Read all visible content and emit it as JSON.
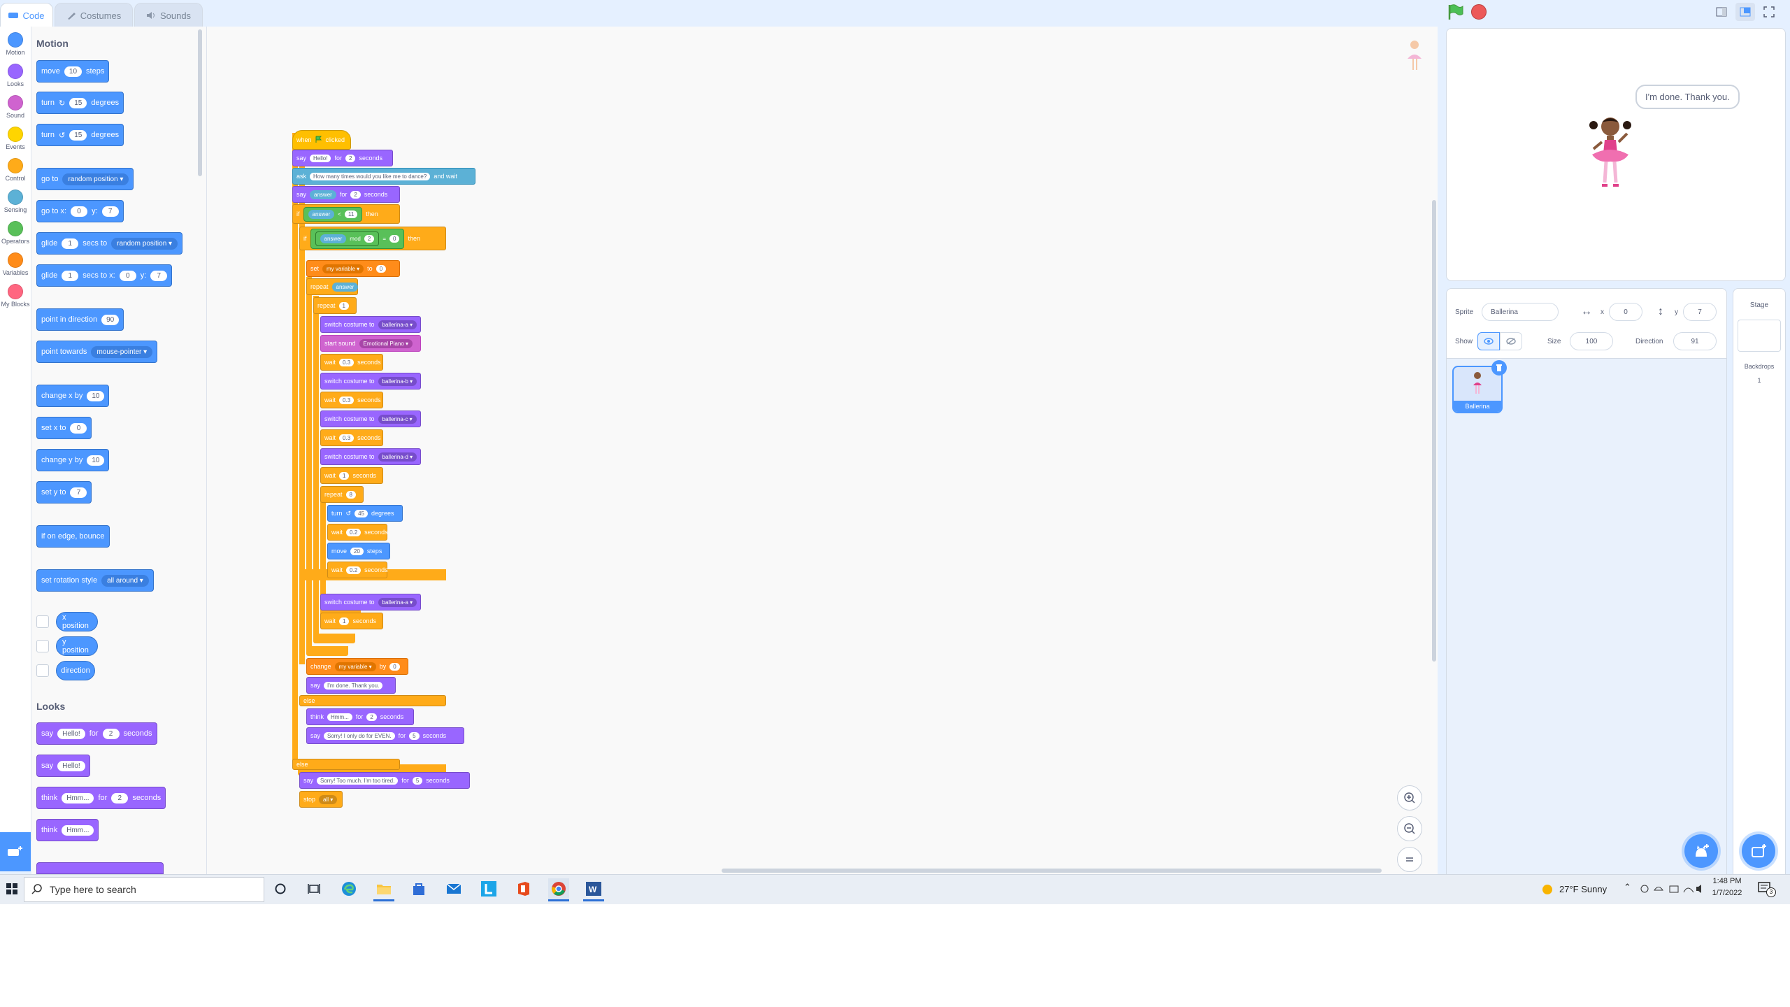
{
  "tabs": {
    "code": "Code",
    "costumes": "Costumes",
    "sounds": "Sounds"
  },
  "categories": [
    {
      "label": "Motion",
      "color": "#4c97ff"
    },
    {
      "label": "Looks",
      "color": "#9966ff"
    },
    {
      "label": "Sound",
      "color": "#cf63cf"
    },
    {
      "label": "Events",
      "color": "#ffd500"
    },
    {
      "label": "Control",
      "color": "#ffab19"
    },
    {
      "label": "Sensing",
      "color": "#5cb1d6"
    },
    {
      "label": "Operators",
      "color": "#59c059"
    },
    {
      "label": "Variables",
      "color": "#ff8c1a"
    },
    {
      "label": "My Blocks",
      "color": "#ff6680"
    }
  ],
  "palette": {
    "motion_title": "Motion",
    "looks_title": "Looks",
    "move": {
      "a": "move",
      "v": "10",
      "b": "steps"
    },
    "turn_cw": {
      "a": "turn",
      "v": "15",
      "b": "degrees"
    },
    "turn_ccw": {
      "a": "turn",
      "v": "15",
      "b": "degrees"
    },
    "goto": {
      "a": "go to",
      "d": "random position"
    },
    "gotoxy": {
      "a": "go to x:",
      "x": "0",
      "yl": "y:",
      "y": "7"
    },
    "glide": {
      "a": "glide",
      "v": "1",
      "b": "secs to",
      "d": "random position"
    },
    "glidexy": {
      "a": "glide",
      "v": "1",
      "b": "secs to x:",
      "x": "0",
      "yl": "y:",
      "y": "7"
    },
    "point_dir": {
      "a": "point in direction",
      "v": "90"
    },
    "point_towards": {
      "a": "point towards",
      "d": "mouse-pointer"
    },
    "change_x": {
      "a": "change x by",
      "v": "10"
    },
    "set_x": {
      "a": "set x to",
      "v": "0"
    },
    "change_y": {
      "a": "change y by",
      "v": "10"
    },
    "set_y": {
      "a": "set y to",
      "v": "7"
    },
    "bounce": "if on edge, bounce",
    "rot_style": {
      "a": "set rotation style",
      "d": "all around"
    },
    "reporters": [
      "x position",
      "y position",
      "direction"
    ],
    "say_for": {
      "a": "say",
      "v": "Hello!",
      "b": "for",
      "n": "2",
      "c": "seconds"
    },
    "say": {
      "a": "say",
      "v": "Hello!"
    },
    "think_for": {
      "a": "think",
      "v": "Hmm...",
      "b": "for",
      "n": "2",
      "c": "seconds"
    },
    "think": {
      "a": "think",
      "v": "Hmm..."
    }
  },
  "script": {
    "hat": {
      "a": "when",
      "b": "clicked"
    },
    "l1": {
      "a": "say",
      "v": "Hello!",
      "b": "for",
      "n": "2",
      "c": "seconds"
    },
    "l2": {
      "a": "ask",
      "v": "How many times would you like me to dance?",
      "b": "and wait"
    },
    "l3": {
      "a": "say",
      "r": "answer",
      "b": "for",
      "n": "2",
      "c": "seconds"
    },
    "l4": {
      "a": "if",
      "r": "answer",
      "op": "<",
      "n": "11",
      "b": "then"
    },
    "l5": {
      "a": "if",
      "r": "answer",
      "m": "mod",
      "n": "2",
      "eq": "=",
      "z": "0",
      "b": "then"
    },
    "l6": {
      "a": "set",
      "d": "my variable",
      "b": "to",
      "v": "0"
    },
    "l7": {
      "a": "repeat",
      "r": "answer"
    },
    "l8": {
      "a": "repeat",
      "v": "1"
    },
    "l9": {
      "a": "switch costume to",
      "d": "ballerina-a"
    },
    "l10": {
      "a": "start sound",
      "d": "Emotional Piano"
    },
    "l11": {
      "a": "wait",
      "v": "0.3",
      "b": "seconds"
    },
    "l12": {
      "a": "switch costume to",
      "d": "ballerina-b"
    },
    "l13": {
      "a": "wait",
      "v": "0.3",
      "b": "seconds"
    },
    "l14": {
      "a": "switch costume to",
      "d": "ballerina-c"
    },
    "l15": {
      "a": "wait",
      "v": "0.3",
      "b": "seconds"
    },
    "l16": {
      "a": "switch costume to",
      "d": "ballerina-d"
    },
    "l17": {
      "a": "wait",
      "v": "1",
      "b": "seconds"
    },
    "l18": {
      "a": "repeat",
      "v": "8"
    },
    "l19": {
      "a": "turn",
      "v": "45",
      "b": "degrees"
    },
    "l20": {
      "a": "wait",
      "v": "0.2",
      "b": "seconds"
    },
    "l21": {
      "a": "move",
      "v": "20",
      "b": "steps"
    },
    "l22": {
      "a": "wait",
      "v": "0.2",
      "b": "seconds"
    },
    "l23": {
      "a": "switch costume to",
      "d": "ballerina-a"
    },
    "l24": {
      "a": "wait",
      "v": "1",
      "b": "seconds"
    },
    "l25": {
      "a": "change",
      "d": "my variable",
      "b": "by",
      "v": "0"
    },
    "l26": {
      "a": "say",
      "v": "I'm done. Thank you."
    },
    "else1": "else",
    "l27": {
      "a": "think",
      "v": "Hmm...",
      "b": "for",
      "n": "2",
      "c": "seconds"
    },
    "l28": {
      "a": "say",
      "v": "Sorry! I only do for EVEN.",
      "b": "for",
      "n": "5",
      "c": "seconds"
    },
    "else2": "else",
    "l29": {
      "a": "say",
      "v": "Sorry! Too much. I'm too tired.",
      "b": "for",
      "n": "5",
      "c": "seconds"
    },
    "l30": {
      "a": "stop",
      "d": "all"
    }
  },
  "stage": {
    "bubble": "I'm done. Thank you."
  },
  "sprite_info": {
    "sprite_label": "Sprite",
    "sprite_name": "Ballerina",
    "x_label": "x",
    "x": "0",
    "y_label": "y",
    "y": "7",
    "show_label": "Show",
    "size_label": "Size",
    "size": "100",
    "direction_label": "Direction",
    "direction": "91"
  },
  "sprite_thumb": "Ballerina",
  "stage_pane": {
    "title": "Stage",
    "backdrops_label": "Backdrops",
    "backdrops_count": "1"
  },
  "taskbar": {
    "search_placeholder": "Type here to search",
    "weather": "27°F  Sunny",
    "time": "1:48 PM",
    "date": "1/7/2022",
    "notif_count": "3"
  }
}
